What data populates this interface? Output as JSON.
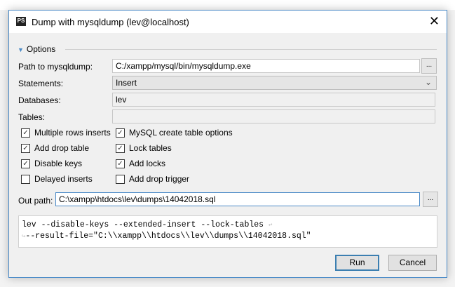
{
  "dialog": {
    "title": "Dump with mysqldump (lev@localhost)",
    "app_icon": "PS",
    "section": "Options",
    "fields": {
      "path_label": "Path to mysqldump:",
      "path_value": "C:/xampp/mysql/bin/mysqldump.exe",
      "statements_label": "Statements:",
      "statements_value": "Insert",
      "databases_label": "Databases:",
      "databases_value": "lev",
      "tables_label": "Tables:",
      "tables_value": ""
    },
    "checkboxes": [
      {
        "label": "Multiple rows inserts",
        "checked": true
      },
      {
        "label": "MySQL create table options",
        "checked": true
      },
      {
        "label": "Add drop table",
        "checked": true
      },
      {
        "label": "Lock tables",
        "checked": true
      },
      {
        "label": "Disable keys",
        "checked": true
      },
      {
        "label": "Add locks",
        "checked": true
      },
      {
        "label": "Delayed inserts",
        "checked": false
      },
      {
        "label": "Add drop trigger",
        "checked": false
      }
    ],
    "out_path_label": "Out path:",
    "out_path_value": "C:\\xampp\\htdocs\\lev\\dumps\\14042018.sql",
    "browse_label": "...",
    "command_line1": "lev --disable-keys --extended-insert --lock-tables",
    "command_line2": "--result-file=\"C:\\\\xampp\\\\htdocs\\\\lev\\\\dumps\\\\14042018.sql\"",
    "run_label": "Run",
    "cancel_label": "Cancel"
  }
}
